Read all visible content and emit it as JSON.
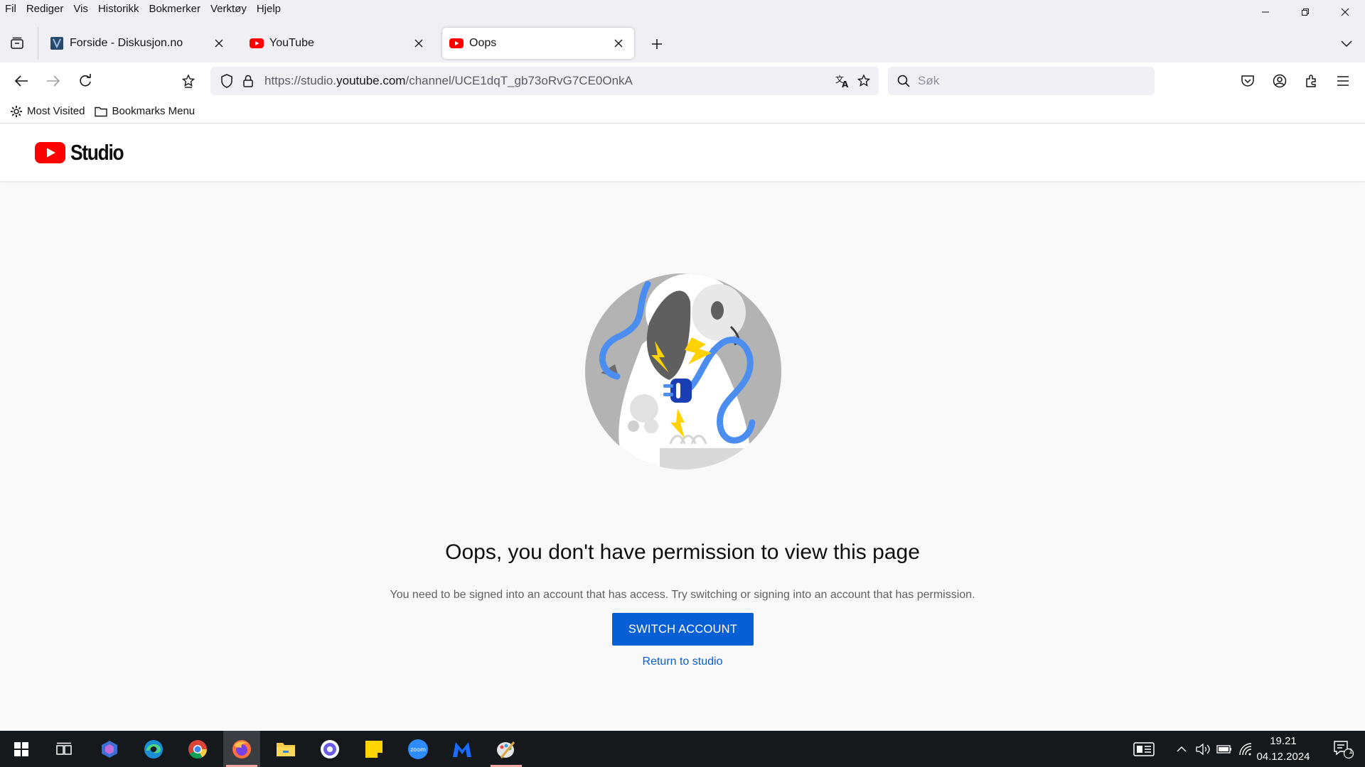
{
  "menubar": {
    "items": [
      "Fil",
      "Rediger",
      "Vis",
      "Historikk",
      "Bokmerker",
      "Verktøy",
      "Hjelp"
    ]
  },
  "tabs": [
    {
      "title": "Forside - Diskusjon.no",
      "favicon": "diskusjon-icon",
      "active": false
    },
    {
      "title": "YouTube",
      "favicon": "youtube-icon",
      "active": false
    },
    {
      "title": "Oops",
      "favicon": "youtube-icon",
      "active": true
    }
  ],
  "navbar": {
    "url_prefix": "https://studio.",
    "url_host": "youtube.com",
    "url_path": "/channel/UCE1dqT_gb73oRvG7CE0OnkA",
    "search_placeholder": "Søk"
  },
  "bookmarks": {
    "items": [
      {
        "label": "Most Visited",
        "icon": "gear-icon"
      },
      {
        "label": "Bookmarks Menu",
        "icon": "folder-icon"
      }
    ]
  },
  "page": {
    "logo_text": "Studio",
    "title": "Oops, you don't have permission to view this page",
    "description": "You need to be signed into an account that has access. Try switching or signing into an account that has permission.",
    "switch_button": "SWITCH ACCOUNT",
    "return_link": "Return to studio"
  },
  "taskbar": {
    "time": "19.21",
    "date": "04.12.2024",
    "notification_count": "1",
    "apps": [
      "windows-start-icon",
      "task-view-icon",
      "copilot-icon",
      "edge-icon",
      "chrome-icon",
      "firefox-icon",
      "file-explorer-icon",
      "settings-app-icon",
      "sticky-notes-icon",
      "zoom-icon",
      "malwarebytes-icon",
      "paint-icon"
    ]
  },
  "colors": {
    "accent_blue": "#065fd4",
    "youtube_red": "#ff0000",
    "taskbar_bg": "#16191c"
  }
}
